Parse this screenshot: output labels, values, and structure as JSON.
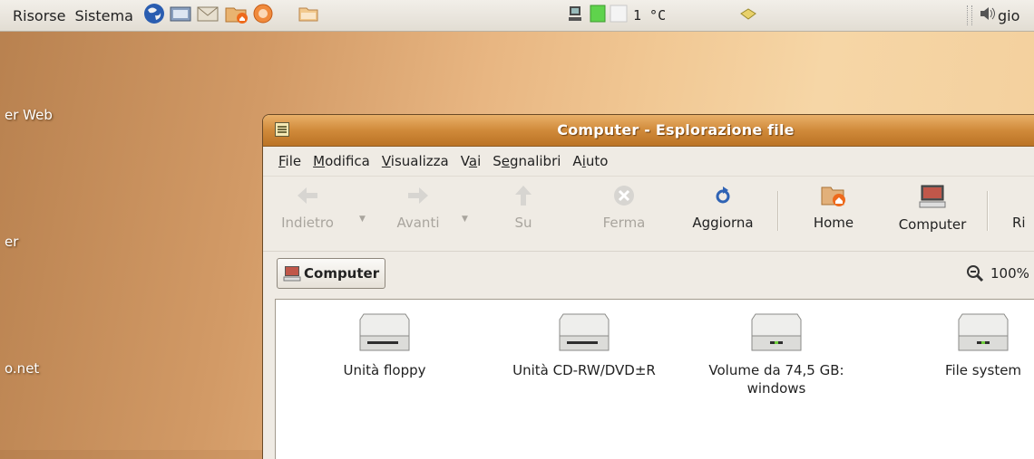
{
  "panel": {
    "menus": [
      "Risorse",
      "Sistema"
    ],
    "temperature": "1 °C",
    "clock": "gio"
  },
  "desktop": {
    "labels": [
      "er Web",
      "er",
      "o.net"
    ]
  },
  "window": {
    "title": "Computer - Esplorazione file",
    "menu": [
      "File",
      "Modifica",
      "Visualizza",
      "Vai",
      "Segnalibri",
      "Aiuto"
    ],
    "toolbar": {
      "back": "Indietro",
      "forward": "Avanti",
      "up": "Su",
      "stop": "Ferma",
      "reload": "Aggiorna",
      "home": "Home",
      "computer": "Computer",
      "search": "Ri"
    },
    "location": "Computer",
    "zoom": "100%",
    "items": [
      {
        "label": "Unità floppy",
        "icon": "floppy-drive-icon"
      },
      {
        "label": "Unità CD-RW/DVD±R",
        "icon": "optical-drive-icon"
      },
      {
        "label": "Volume da 74,5 GB: windows",
        "icon": "hard-drive-icon"
      },
      {
        "label": "File system",
        "icon": "hard-drive-icon"
      }
    ]
  },
  "colors": {
    "titlebar": "#d08a3a",
    "desktop": "#e8b682"
  }
}
